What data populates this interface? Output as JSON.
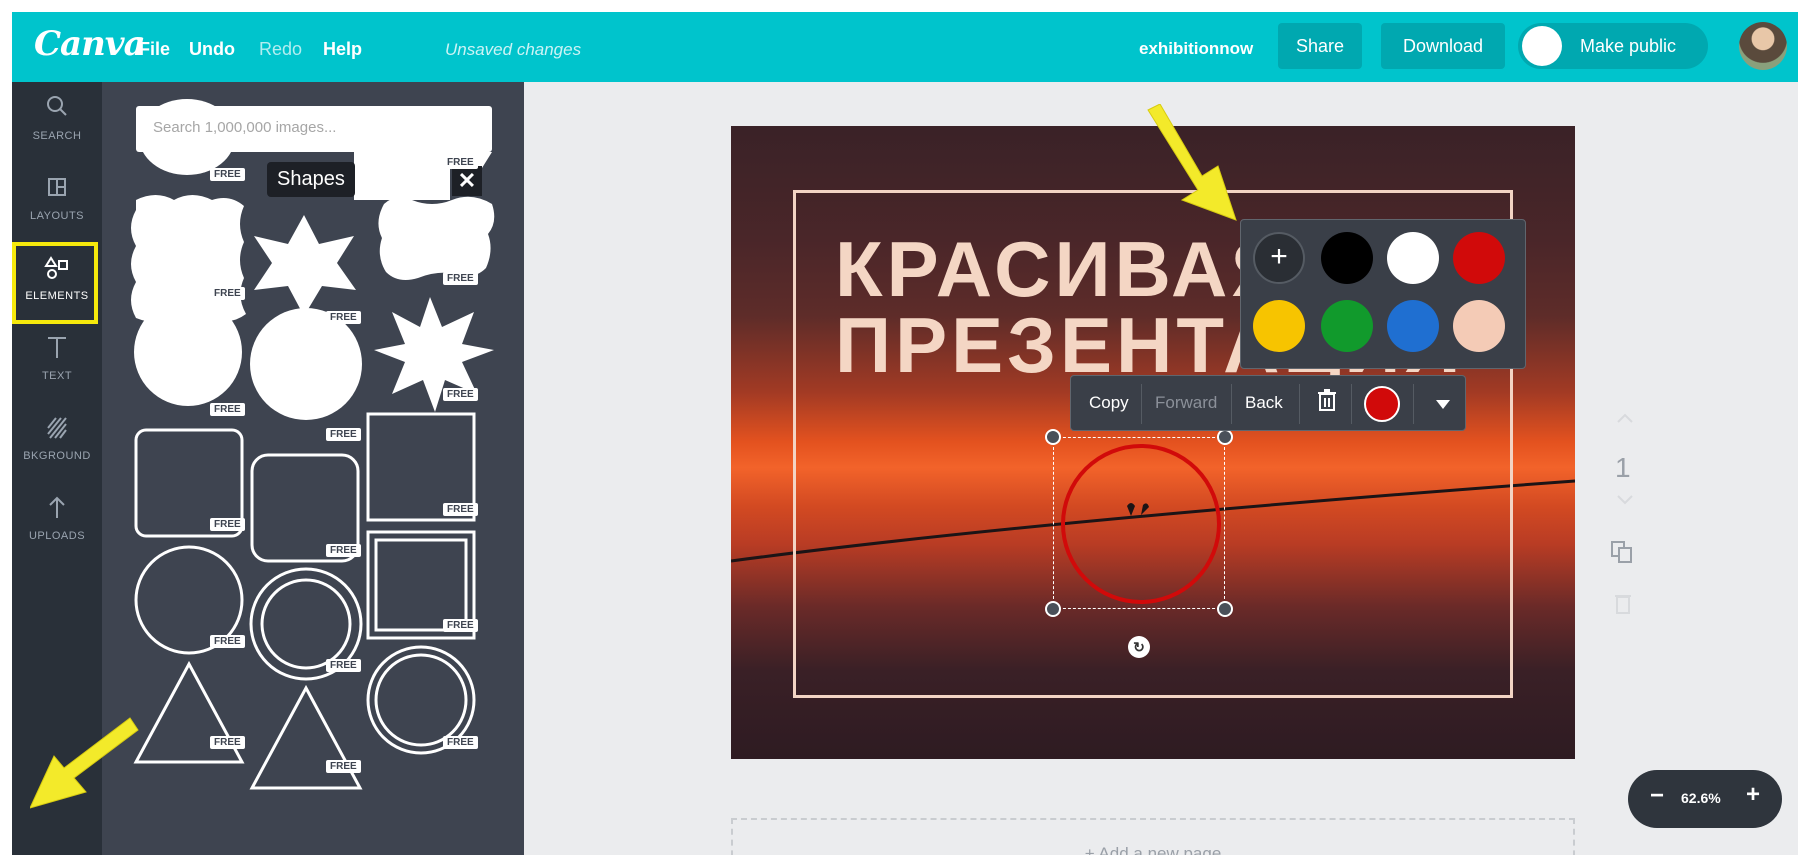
{
  "app": {
    "logo": "Canva"
  },
  "menu": {
    "file": "File",
    "undo": "Undo",
    "redo": "Redo",
    "help": "Help",
    "status": "Unsaved changes"
  },
  "header": {
    "username": "exhibitionnow",
    "share_label": "Share",
    "download_label": "Download",
    "make_public_label": "Make public"
  },
  "sidebar": {
    "items": [
      {
        "label": "SEARCH",
        "icon": "search-icon"
      },
      {
        "label": "LAYOUTS",
        "icon": "layouts-icon"
      },
      {
        "label": "ELEMENTS",
        "icon": "elements-icon",
        "active": true
      },
      {
        "label": "TEXT",
        "icon": "text-icon"
      },
      {
        "label": "BKGROUND",
        "icon": "background-icon"
      },
      {
        "label": "UPLOADS",
        "icon": "upload-icon"
      }
    ]
  },
  "panel": {
    "search_placeholder": "Search 1,000,000 images...",
    "tooltip": "Shapes",
    "close_symbol": "✕",
    "free_badge": "FREE"
  },
  "design": {
    "title_line1": "КРАСИВАЯ",
    "title_line2": "ПРЕЗЕНТАЦИЯ"
  },
  "element_toolbar": {
    "copy": "Copy",
    "forward": "Forward",
    "back": "Back",
    "delete_icon": "trash-icon",
    "current_color": "#d10a0a",
    "more_icon": "caret-down-icon"
  },
  "palette": {
    "add_symbol": "+",
    "colors": [
      "#000000",
      "#ffffff",
      "#d10a0a",
      "#f7c400",
      "#119a2c",
      "#1f6fd1",
      "#f4cbb6"
    ]
  },
  "page_tools": {
    "page_number": "1"
  },
  "add_page_label": "+ Add a new page",
  "zoom": {
    "minus": "−",
    "value": "62.6%",
    "plus": "+"
  },
  "colors": {
    "topbar": "#00c4cc",
    "rail": "#293039",
    "panel": "#3e4450",
    "highlight": "#f6e90c"
  }
}
